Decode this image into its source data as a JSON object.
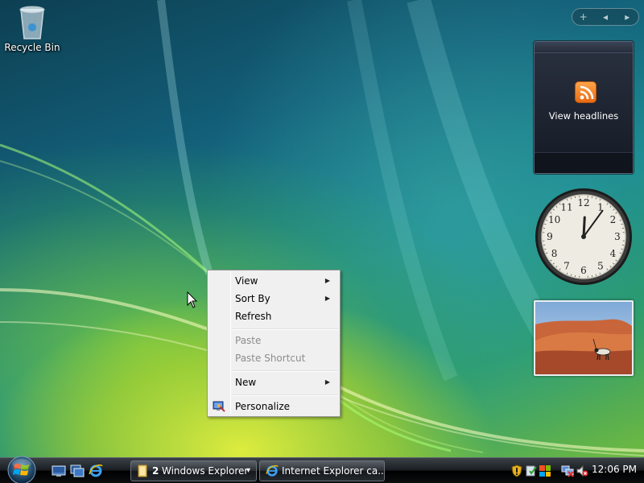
{
  "desktop": {
    "recycle_bin_label": "Recycle Bin"
  },
  "sidebar": {
    "controls": {
      "add": "+",
      "prev": "◂",
      "next": "▸"
    },
    "feed_gadget": {
      "label": "View headlines"
    },
    "clock_gadget": {
      "numbers": [
        "12",
        "1",
        "2",
        "3",
        "4",
        "5",
        "6",
        "7",
        "8",
        "9",
        "10",
        "11"
      ],
      "time": "12:06"
    },
    "slideshow_gadget": {
      "subject": "oryx-in-desert"
    }
  },
  "context_menu": {
    "items": [
      {
        "label": "View",
        "submenu": true,
        "disabled": false
      },
      {
        "label": "Sort By",
        "submenu": true,
        "disabled": false
      },
      {
        "label": "Refresh",
        "submenu": false,
        "disabled": false
      },
      {
        "label": "Paste",
        "submenu": false,
        "disabled": true
      },
      {
        "label": "Paste Shortcut",
        "submenu": false,
        "disabled": true
      },
      {
        "label": "New",
        "submenu": true,
        "disabled": false
      },
      {
        "label": "Personalize",
        "submenu": false,
        "disabled": false,
        "icon": "personalize-icon"
      }
    ]
  },
  "taskbar": {
    "quick_launch": [
      "show-desktop-icon",
      "switch-windows-icon",
      "internet-explorer-icon"
    ],
    "buttons": [
      {
        "count": "2",
        "label": "Windows Explorer",
        "icon": "folder-icon",
        "dropdown": "▾"
      },
      {
        "label": "Internet Explorer ca...",
        "icon": "internet-explorer-icon"
      }
    ],
    "tray": {
      "icons": [
        "security-shield-icon",
        "windows-defender-icon",
        "windows-update-icon",
        "network-icon",
        "volume-muted-icon"
      ],
      "clock": "12:06 PM"
    }
  },
  "colors": {
    "menu_bg": "#f0f0f0",
    "menu_disabled_text": "#8d8d8d",
    "rss_orange": "#f7941d"
  }
}
